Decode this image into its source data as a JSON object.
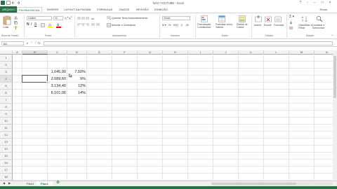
{
  "window": {
    "title": "NÃO YOUTUBE - Excel",
    "user": "Ercan"
  },
  "tabs": [
    "ARQUIVO",
    "PÁGINA INICIAL",
    "INSERIR",
    "LAYOUT DA PÁGINA",
    "FÓRMULAS",
    "DADOS",
    "REVISÃO",
    "EXIBIÇÃO"
  ],
  "ribbon": {
    "clipboard": {
      "paste": "Colar",
      "group": "Área de Transf."
    },
    "font": {
      "name": "Calibri",
      "size": "11",
      "group": "Fonte"
    },
    "alignment": {
      "wrap": "Quebrar Texto Automaticamente",
      "merge": "Mesclar e Centralizar",
      "group": "Alinhamento"
    },
    "number": {
      "format": "Geral",
      "group": "Número"
    },
    "styles": {
      "conditional": "Formatação Condicional",
      "table": "Formatar como Tabela",
      "cell": "Estilos de Célula",
      "group": "Estilo"
    },
    "cells": {
      "insert": "Inserir",
      "delete": "Excluir",
      "format": "Formatar",
      "group": "Células"
    },
    "editing": {
      "sort": "Classificar e Filtrar",
      "find": "Localizar e Selecionar",
      "group": "Edição"
    }
  },
  "formula_bar": {
    "name_box": "B4",
    "fx": "fx",
    "value": ""
  },
  "grid": {
    "columns": [
      "A",
      "B",
      "C",
      "D",
      "E",
      "F",
      "G",
      "H",
      "I",
      "J",
      "K",
      "L",
      "M",
      "N",
      "O"
    ],
    "rows": [
      "1",
      "2",
      "3",
      "4",
      "5",
      "6",
      "7",
      "8",
      "9",
      "10",
      "11",
      "12",
      "13",
      "14",
      "15",
      "16",
      "17",
      "18"
    ],
    "selected_column": "B",
    "selected_row": "4",
    "data": [
      {
        "row": "3",
        "c": "1.045,00",
        "d": "7,50%"
      },
      {
        "row": "4",
        "c": "2.089,60",
        "d": "9%"
      },
      {
        "row": "5",
        "c": "3.134,40",
        "d": "12%"
      },
      {
        "row": "6",
        "c": "6.101,06",
        "d": "14%"
      }
    ]
  },
  "sheets": [
    "Plan1",
    "Plan1"
  ],
  "colors": {
    "accent": "#217346"
  }
}
